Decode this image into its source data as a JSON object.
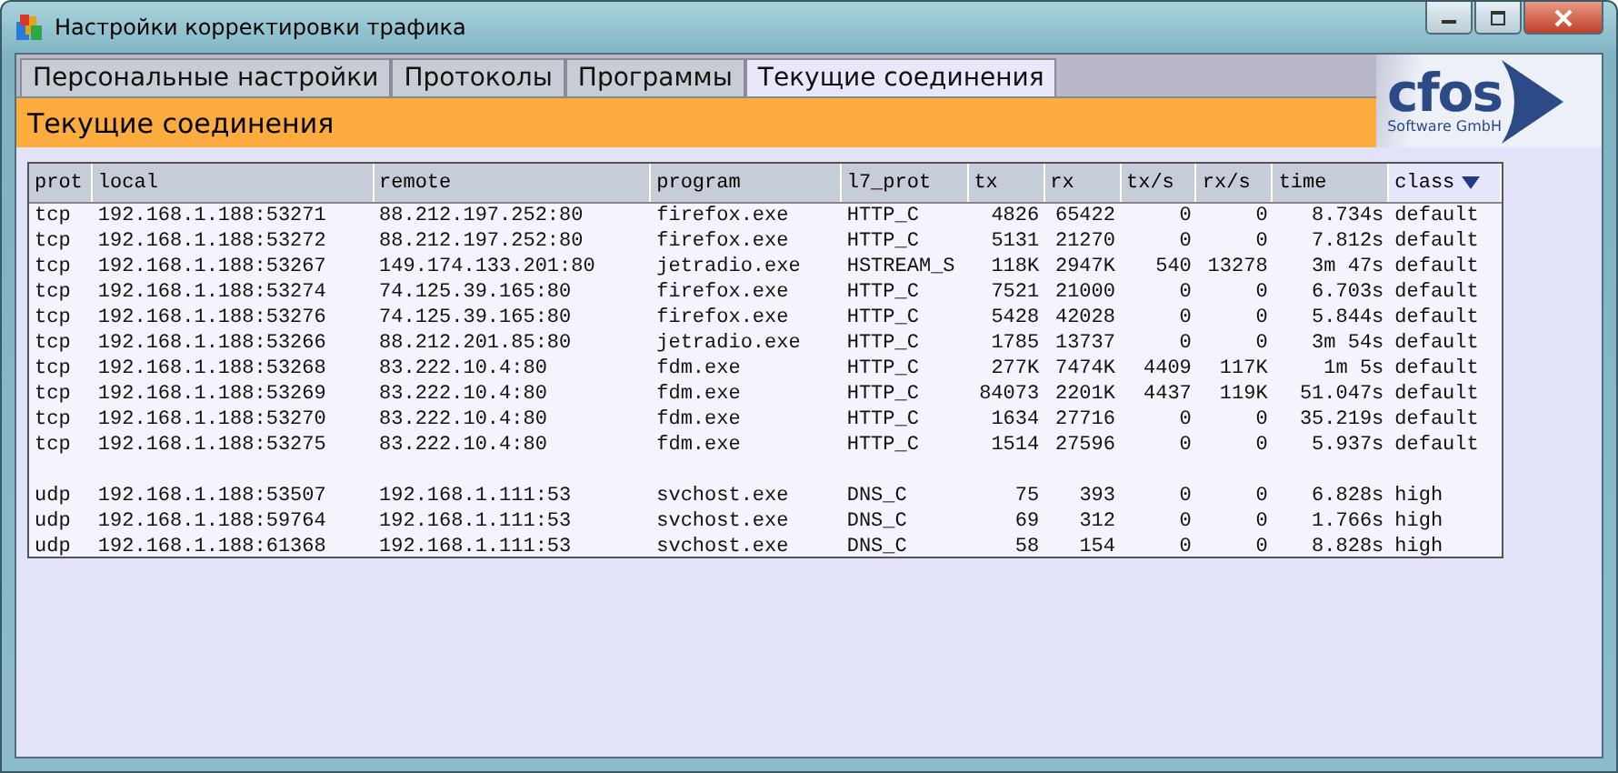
{
  "window": {
    "title": "Настройки корректировки трафика"
  },
  "tabs": [
    {
      "label": "Персональные настройки",
      "selected": false
    },
    {
      "label": "Протоколы",
      "selected": false
    },
    {
      "label": "Программы",
      "selected": false
    },
    {
      "label": "Текущие соединения",
      "selected": true
    }
  ],
  "logo": {
    "name": "cfos",
    "subtitle": "Software GmbH"
  },
  "section_title": "Текущие соединения",
  "table": {
    "columns": [
      {
        "label": "prot",
        "kind": "text",
        "sorted": false
      },
      {
        "label": "local",
        "kind": "text",
        "sorted": false
      },
      {
        "label": "remote",
        "kind": "text",
        "sorted": false
      },
      {
        "label": "program",
        "kind": "text",
        "sorted": false
      },
      {
        "label": "l7_prot",
        "kind": "text",
        "sorted": false
      },
      {
        "label": "tx",
        "kind": "number",
        "sorted": false
      },
      {
        "label": "rx",
        "kind": "number",
        "sorted": false
      },
      {
        "label": "tx/s",
        "kind": "number",
        "sorted": false
      },
      {
        "label": "rx/s",
        "kind": "number",
        "sorted": false
      },
      {
        "label": "time",
        "kind": "number",
        "sorted": false
      },
      {
        "label": "class",
        "kind": "text",
        "sorted": true
      }
    ],
    "groups": [
      {
        "rows": [
          [
            "tcp",
            "192.168.1.188:53271",
            "88.212.197.252:80",
            "firefox.exe",
            "HTTP_C",
            "4826",
            "65422",
            "0",
            "0",
            "8.734s",
            "default"
          ],
          [
            "tcp",
            "192.168.1.188:53272",
            "88.212.197.252:80",
            "firefox.exe",
            "HTTP_C",
            "5131",
            "21270",
            "0",
            "0",
            "7.812s",
            "default"
          ],
          [
            "tcp",
            "192.168.1.188:53267",
            "149.174.133.201:80",
            "jetradio.exe",
            "HSTREAM_S",
            "118K",
            "2947K",
            "540",
            "13278",
            "3m 47s",
            "default"
          ],
          [
            "tcp",
            "192.168.1.188:53274",
            "74.125.39.165:80",
            "firefox.exe",
            "HTTP_C",
            "7521",
            "21000",
            "0",
            "0",
            "6.703s",
            "default"
          ],
          [
            "tcp",
            "192.168.1.188:53276",
            "74.125.39.165:80",
            "firefox.exe",
            "HTTP_C",
            "5428",
            "42028",
            "0",
            "0",
            "5.844s",
            "default"
          ],
          [
            "tcp",
            "192.168.1.188:53266",
            "88.212.201.85:80",
            "jetradio.exe",
            "HTTP_C",
            "1785",
            "13737",
            "0",
            "0",
            "3m 54s",
            "default"
          ],
          [
            "tcp",
            "192.168.1.188:53268",
            "83.222.10.4:80",
            "fdm.exe",
            "HTTP_C",
            "277K",
            "7474K",
            "4409",
            "117K",
            "1m 5s",
            "default"
          ],
          [
            "tcp",
            "192.168.1.188:53269",
            "83.222.10.4:80",
            "fdm.exe",
            "HTTP_C",
            "84073",
            "2201K",
            "4437",
            "119K",
            "51.047s",
            "default"
          ],
          [
            "tcp",
            "192.168.1.188:53270",
            "83.222.10.4:80",
            "fdm.exe",
            "HTTP_C",
            "1634",
            "27716",
            "0",
            "0",
            "35.219s",
            "default"
          ],
          [
            "tcp",
            "192.168.1.188:53275",
            "83.222.10.4:80",
            "fdm.exe",
            "HTTP_C",
            "1514",
            "27596",
            "0",
            "0",
            "5.937s",
            "default"
          ]
        ]
      },
      {
        "rows": [
          [
            "udp",
            "192.168.1.188:53507",
            "192.168.1.111:53",
            "svchost.exe",
            "DNS_C",
            "75",
            "393",
            "0",
            "0",
            "6.828s",
            "high"
          ],
          [
            "udp",
            "192.168.1.188:59764",
            "192.168.1.111:53",
            "svchost.exe",
            "DNS_C",
            "69",
            "312",
            "0",
            "0",
            "1.766s",
            "high"
          ],
          [
            "udp",
            "192.168.1.188:61368",
            "192.168.1.111:53",
            "svchost.exe",
            "DNS_C",
            "58",
            "154",
            "0",
            "0",
            "8.828s",
            "high"
          ]
        ]
      }
    ]
  }
}
